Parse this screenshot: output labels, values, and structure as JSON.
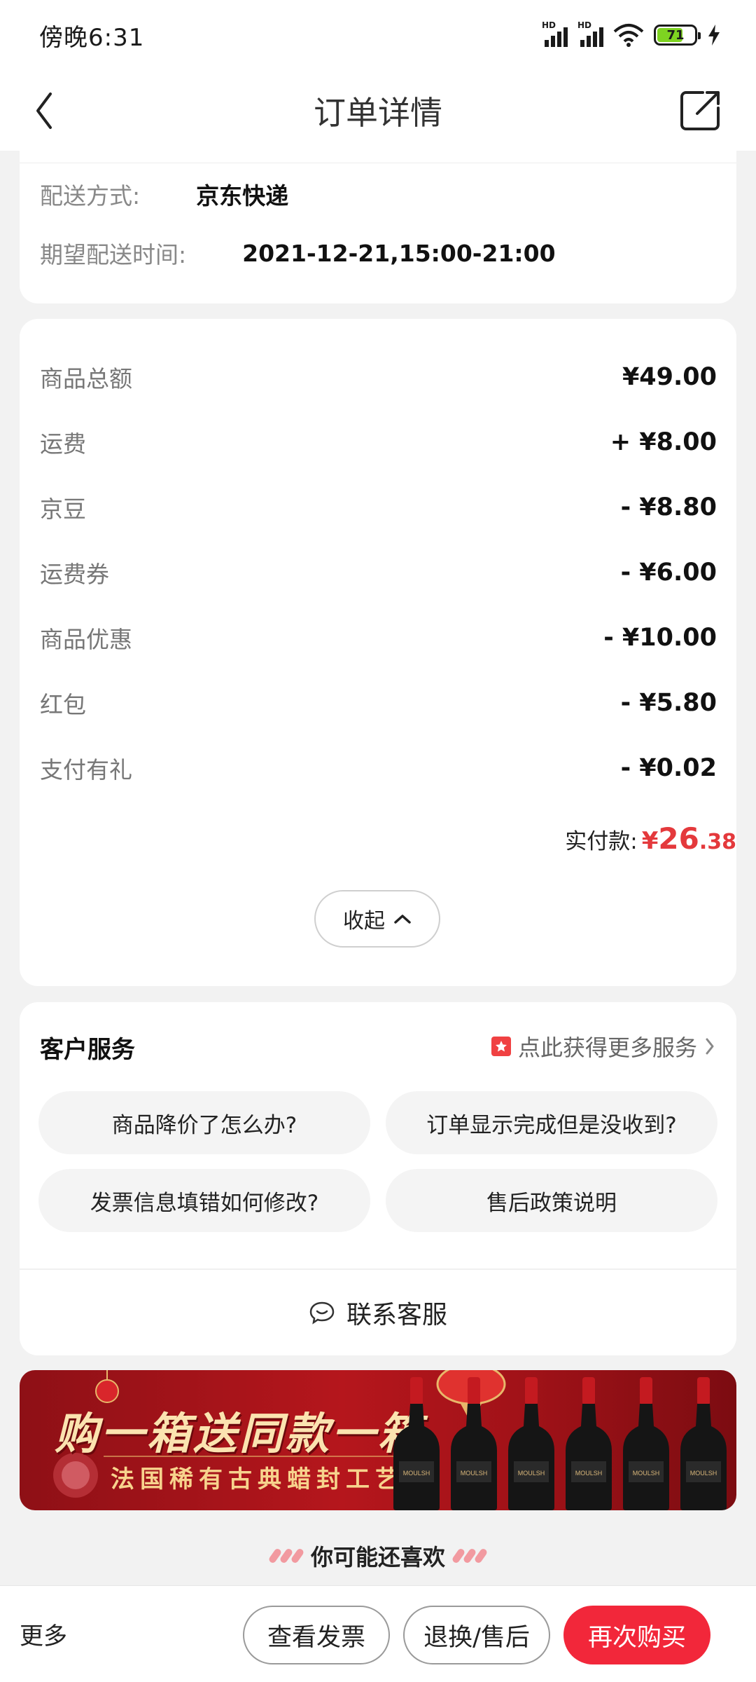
{
  "status_bar": {
    "time": "傍晚6:31",
    "signal_1_label": "HD",
    "signal_2_label": "HD",
    "battery_level": "71",
    "icons": [
      "signal-icon",
      "signal-icon",
      "wifi-icon",
      "battery-icon",
      "charging-icon"
    ]
  },
  "nav": {
    "title": "订单详情",
    "back_icon": "chevron-left-icon",
    "share_icon": "share-icon"
  },
  "delivery": {
    "method_label": "配送方式:",
    "method_value": "京东快递",
    "time_label": "期望配送时间:",
    "time_value": "2021-12-21,15:00-21:00"
  },
  "amounts": {
    "rows": [
      {
        "label": "商品总额",
        "value": "¥49.00"
      },
      {
        "label": "运费",
        "value": "+ ¥8.00"
      },
      {
        "label": "京豆",
        "value": "- ¥8.80"
      },
      {
        "label": "运费券",
        "value": "- ¥6.00"
      },
      {
        "label": "商品优惠",
        "value": "- ¥10.00"
      },
      {
        "label": "红包",
        "value": "- ¥5.80"
      },
      {
        "label": "支付有礼",
        "value": "- ¥0.02"
      }
    ],
    "paid_label": "实付款:",
    "paid_currency": "¥",
    "paid_integer": "26",
    "paid_decimal": ".38",
    "collapse_label": "收起",
    "accent_color": "#e4393c"
  },
  "service": {
    "title": "客户服务",
    "more_label": "点此获得更多服务",
    "questions": [
      "商品降价了怎么办?",
      "订单显示完成但是没收到?",
      "发票信息填错如何修改?",
      "售后政策说明"
    ],
    "contact_label": "联系客服"
  },
  "banner": {
    "headline": "购一箱送同款一箱",
    "subline": "法国稀有古典蜡封工艺",
    "bottle_label": "MOULSH"
  },
  "recommend": {
    "title": "你可能还喜欢"
  },
  "bottom_bar": {
    "more_label": "更多",
    "invoice_label": "查看发票",
    "return_label": "退换/售后",
    "rebuy_label": "再次购买",
    "primary_color": "#f2273a"
  }
}
